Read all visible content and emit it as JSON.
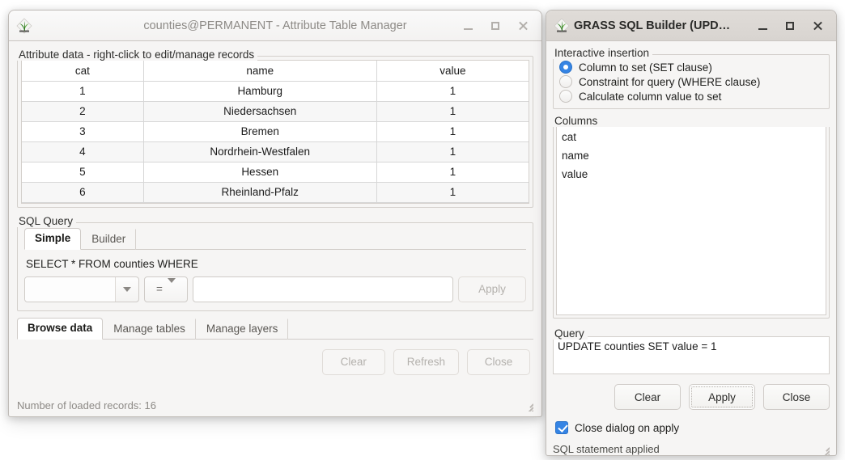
{
  "attribute_window": {
    "title": "counties@PERMANENT - Attribute Table Manager",
    "icon": "grass-gis-icon",
    "controls": {
      "minimize": "minimize-icon",
      "maximize": "maximize-icon",
      "close": "close-icon"
    },
    "attr_group_title": "Attribute data - right-click to edit/manage records",
    "table": {
      "columns": [
        "cat",
        "name",
        "value"
      ],
      "rows": [
        [
          "1",
          "Hamburg",
          "1"
        ],
        [
          "2",
          "Niedersachsen",
          "1"
        ],
        [
          "3",
          "Bremen",
          "1"
        ],
        [
          "4",
          "Nordrhein-Westfalen",
          "1"
        ],
        [
          "5",
          "Hessen",
          "1"
        ],
        [
          "6",
          "Rheinland-Pfalz",
          "1"
        ]
      ]
    },
    "sql_group_title": "SQL Query",
    "query_tabs": [
      {
        "label": "Simple",
        "active": true
      },
      {
        "label": "Builder",
        "active": false
      }
    ],
    "sql_prefix": "SELECT * FROM counties WHERE",
    "column_combo_value": "",
    "operator_combo_value": "=",
    "value_input": "",
    "value_placeholder": "",
    "apply_label": "Apply",
    "bottom_tabs": [
      {
        "label": "Browse data",
        "active": true
      },
      {
        "label": "Manage tables",
        "active": false
      },
      {
        "label": "Manage layers",
        "active": false
      }
    ],
    "buttons": {
      "clear": "Clear",
      "refresh": "Refresh",
      "close": "Close"
    },
    "status": "Number of loaded records: 16"
  },
  "sql_builder_window": {
    "title": "GRASS SQL Builder (UPD…",
    "icon": "grass-gis-icon",
    "controls": {
      "minimize": "minimize-icon",
      "maximize": "maximize-icon",
      "close": "close-icon"
    },
    "insertion_group_title": "Interactive insertion",
    "radios": [
      {
        "label": "Column to set (SET clause)",
        "checked": true
      },
      {
        "label": "Constraint for query (WHERE clause)",
        "checked": false
      },
      {
        "label": "Calculate column value to set",
        "checked": false
      }
    ],
    "columns_group_title": "Columns",
    "columns": [
      "cat",
      "name",
      "value"
    ],
    "query_group_title": "Query",
    "query_text": "UPDATE counties SET value = 1",
    "buttons": {
      "clear": "Clear",
      "apply": "Apply",
      "close": "Close"
    },
    "close_on_apply": {
      "label": "Close dialog on apply",
      "checked": true
    },
    "status": "SQL statement applied"
  },
  "colors": {
    "accent": "#3584e4",
    "window_bg": "#f6f5f4",
    "titlebar_active": "#d8d4d0",
    "titlebar_inactive": "#f3f2f1",
    "row_alt": "#f7f7f7",
    "border": "#d3cfcb",
    "disabled_text": "#b4b1ad"
  }
}
